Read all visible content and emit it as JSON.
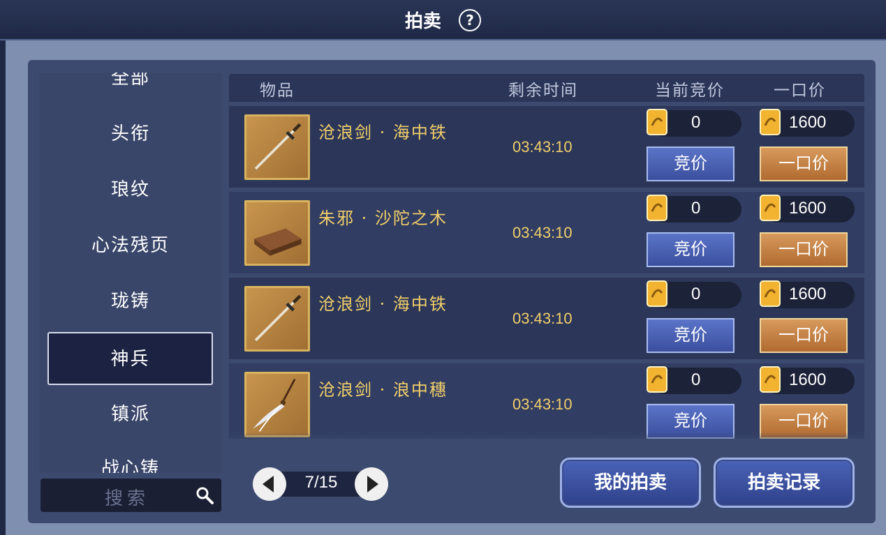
{
  "title": "拍卖",
  "help_label": "?",
  "categories": [
    {
      "label": "全部",
      "active": false
    },
    {
      "label": "头衔",
      "active": false
    },
    {
      "label": "琅纹",
      "active": false
    },
    {
      "label": "心法残页",
      "active": false
    },
    {
      "label": "珑铸",
      "active": false
    },
    {
      "label": "神兵",
      "active": true
    },
    {
      "label": "镇派",
      "active": false
    },
    {
      "label": "战心铸",
      "active": false
    }
  ],
  "search": {
    "placeholder": "搜索"
  },
  "columns": {
    "item": "物品",
    "time": "剩余时间",
    "bid": "当前竞价",
    "buyout": "一口价"
  },
  "items": [
    {
      "name": "沧浪剑 · 海中铁",
      "time": "03:43:10",
      "bid": "0",
      "buyout": "1600",
      "icon": "sword-icon",
      "bid_btn": "竞价",
      "buy_btn": "一口价"
    },
    {
      "name": "朱邪 · 沙陀之木",
      "time": "03:43:10",
      "bid": "0",
      "buyout": "1600",
      "icon": "wood-icon",
      "bid_btn": "竞价",
      "buy_btn": "一口价"
    },
    {
      "name": "沧浪剑 · 海中铁",
      "time": "03:43:10",
      "bid": "0",
      "buyout": "1600",
      "icon": "sword-icon",
      "bid_btn": "竞价",
      "buy_btn": "一口价"
    },
    {
      "name": "沧浪剑 · 浪中穗",
      "time": "03:43:10",
      "bid": "0",
      "buyout": "1600",
      "icon": "tassel-icon",
      "bid_btn": "竞价",
      "buy_btn": "一口价"
    }
  ],
  "pager": {
    "text": "7/15"
  },
  "buttons": {
    "my_auction": "我的拍卖",
    "auction_record": "拍卖记录"
  },
  "colors": {
    "gold_text": "#f2cf6a",
    "bid_button": "#4a63b8",
    "buyout_button": "#c4844a"
  }
}
